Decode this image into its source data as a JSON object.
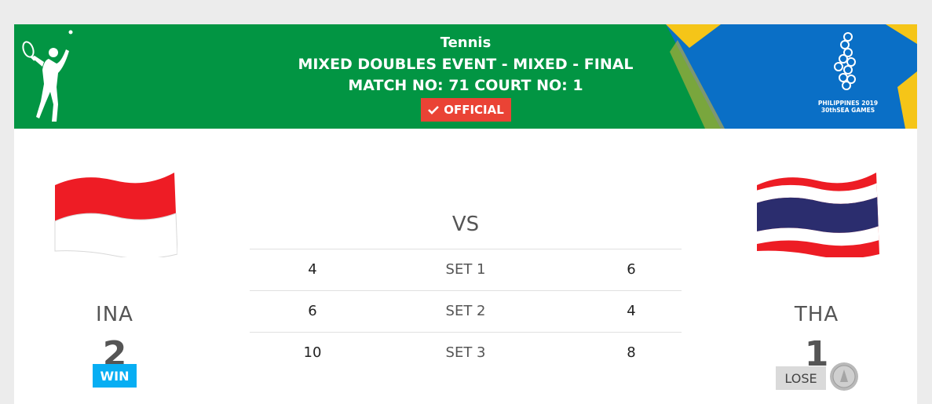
{
  "header": {
    "sport": "Tennis",
    "event": "MIXED DOUBLES EVENT - MIXED - FINAL",
    "match": "MATCH NO: 71 COURT NO: 1",
    "status_badge": "OFFICIAL",
    "status_icon": "check-icon",
    "logo_lines": [
      "PHILIPPINES 2019",
      "30th SEA GAMES"
    ],
    "colors": {
      "banner": "#029543",
      "badge": "#ea4335"
    }
  },
  "teams": {
    "left": {
      "code": "INA",
      "score": "2",
      "result": "WIN",
      "flag": "indonesia-flag"
    },
    "right": {
      "code": "THA",
      "score": "1",
      "result": "LOSE",
      "flag": "thailand-flag",
      "medal": "silver-medal-icon"
    }
  },
  "vs_label": "VS",
  "sets": [
    {
      "left": "4",
      "label": "SET 1",
      "right": "6"
    },
    {
      "left": "6",
      "label": "SET 2",
      "right": "4"
    },
    {
      "left": "10",
      "label": "SET 3",
      "right": "8"
    }
  ],
  "colors": {
    "win": "#07aef3",
    "lose": "#dadada"
  }
}
